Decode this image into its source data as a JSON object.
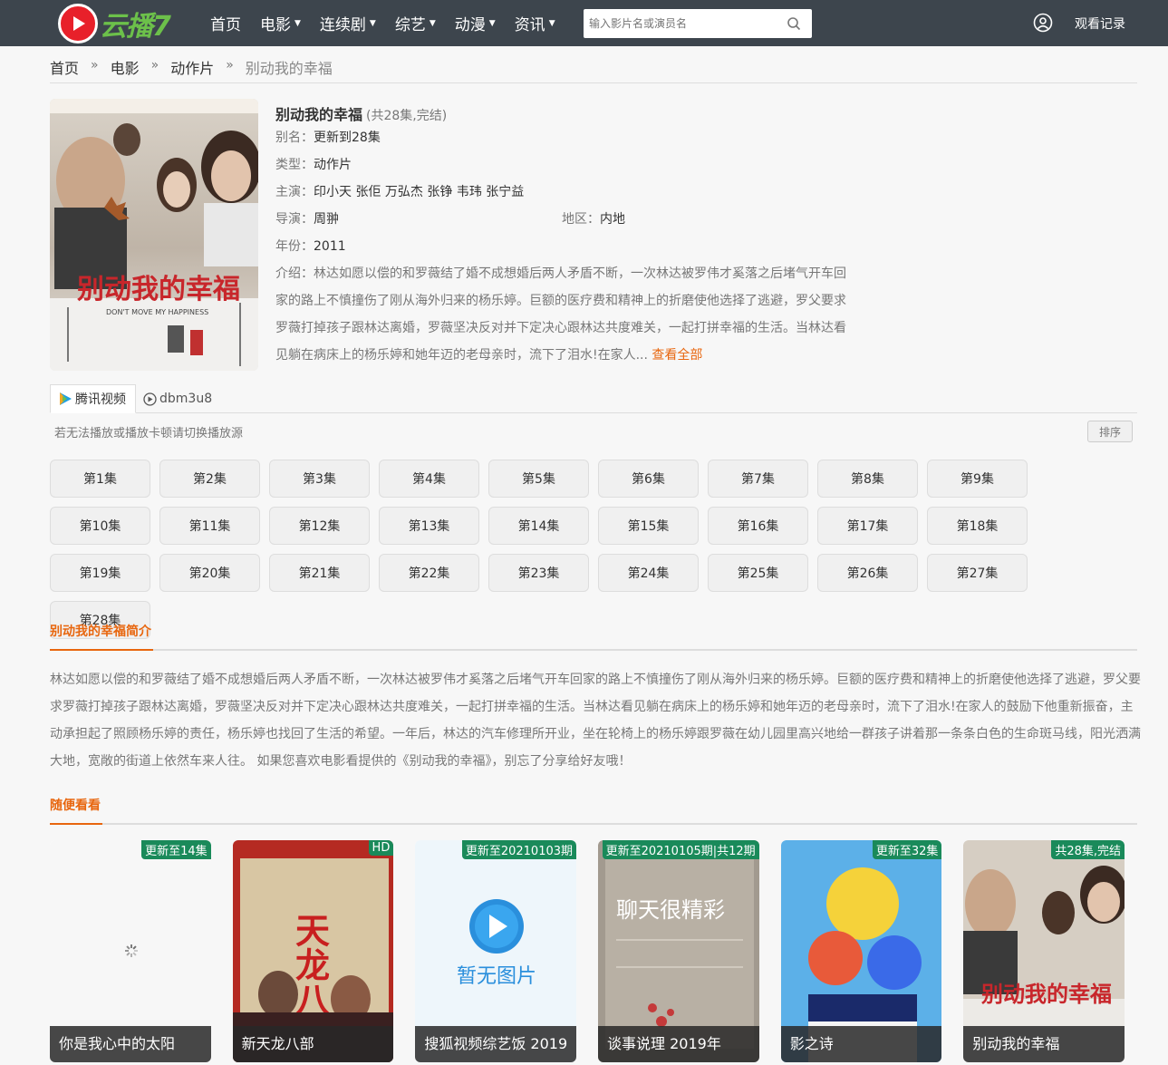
{
  "header": {
    "logo_text": "云播7",
    "nav": [
      {
        "label": "首页",
        "dropdown": false
      },
      {
        "label": "电影",
        "dropdown": true
      },
      {
        "label": "连续剧",
        "dropdown": true
      },
      {
        "label": "综艺",
        "dropdown": true
      },
      {
        "label": "动漫",
        "dropdown": true
      },
      {
        "label": "资讯",
        "dropdown": true
      }
    ],
    "search_placeholder": "输入影片名或演员名",
    "history_label": "观看记录"
  },
  "breadcrumb": {
    "items": [
      "首页",
      "电影",
      "动作片"
    ],
    "current": "别动我的幸福",
    "separator": "»"
  },
  "detail": {
    "poster_title": "别动我的幸福",
    "poster_subtitle": "DON'T MOVE MY HAPPINESS",
    "title": "别动我的幸福",
    "title_extra": "(共28集,完结)",
    "alias_label": "别名：",
    "alias": "更新到28集",
    "type_label": "类型：",
    "type": "动作片",
    "cast_label": "主演：",
    "cast": "印小天 张佢 万弘杰 张铮 韦玮 张宁益",
    "director_label": "导演：",
    "director": "周翀",
    "region_label": "地区：",
    "region": "内地",
    "year_label": "年份：",
    "year": "2011",
    "intro_label": "介绍：",
    "intro": "林达如愿以偿的和罗薇结了婚不成想婚后两人矛盾不断，一次林达被罗伟才奚落之后堵气开车回家的路上不慎撞伤了刚从海外归来的杨乐婷。巨额的医疗费和精神上的折磨使他选择了逃避，罗父要求罗薇打掉孩子跟林达离婚，罗薇坚决反对并下定决心跟林达共度难关，一起打拼幸福的生活。当林达看见躺在病床上的杨乐婷和她年迈的老母亲时，流下了泪水!在家人...",
    "more_label": "查看全部"
  },
  "sources": {
    "tabs": [
      "腾讯视频",
      "dbm3u8"
    ],
    "active_index": 0,
    "notice": "若无法播放或播放卡顿请切换播放源",
    "sort_label": "排序"
  },
  "episodes": [
    "第1集",
    "第2集",
    "第3集",
    "第4集",
    "第5集",
    "第6集",
    "第7集",
    "第8集",
    "第9集",
    "第10集",
    "第11集",
    "第12集",
    "第13集",
    "第14集",
    "第15集",
    "第16集",
    "第17集",
    "第18集",
    "第19集",
    "第20集",
    "第21集",
    "第22集",
    "第23集",
    "第24集",
    "第25集",
    "第26集",
    "第27集",
    "第28集"
  ],
  "synopsis": {
    "heading": "别动我的幸福简介",
    "text": "林达如愿以偿的和罗薇结了婚不成想婚后两人矛盾不断，一次林达被罗伟才奚落之后堵气开车回家的路上不慎撞伤了刚从海外归来的杨乐婷。巨额的医疗费和精神上的折磨使他选择了逃避，罗父要求罗薇打掉孩子跟林达离婚，罗薇坚决反对并下定决心跟林达共度难关，一起打拼幸福的生活。当林达看见躺在病床上的杨乐婷和她年迈的老母亲时，流下了泪水!在家人的鼓励下他重新振奋，主动承担起了照顾杨乐婷的责任，杨乐婷也找回了生活的希望。一年后，林达的汽车修理所开业，坐在轮椅上的杨乐婷跟罗薇在幼儿园里高兴地给一群孩子讲着那一条条白色的生命斑马线，阳光洒满大地，宽敞的街道上依然车来人往。 如果您喜欢电影看提供的《别动我的幸福》，别忘了分享给好友哦！"
  },
  "related": {
    "heading": "随便看看",
    "cards": [
      {
        "title": "你是我心中的太阳",
        "badge": "更新至14集",
        "art": "loading"
      },
      {
        "title": "新天龙八部",
        "badge": "HD",
        "art": "tianlong",
        "poster_text": "天龙八部"
      },
      {
        "title": "搜狐视频综艺饭 2019",
        "badge": "更新至20210103期",
        "art": "noimage",
        "poster_text": "暂无图片"
      },
      {
        "title": "谈事说理 2019年",
        "badge": "更新至20210105期|共12期",
        "art": "talk",
        "poster_text": "聊天很精彩"
      },
      {
        "title": "影之诗",
        "badge": "更新至32集",
        "art": "anime"
      },
      {
        "title": "别动我的幸福",
        "badge": "共28集,完结",
        "art": "drama"
      }
    ]
  }
}
